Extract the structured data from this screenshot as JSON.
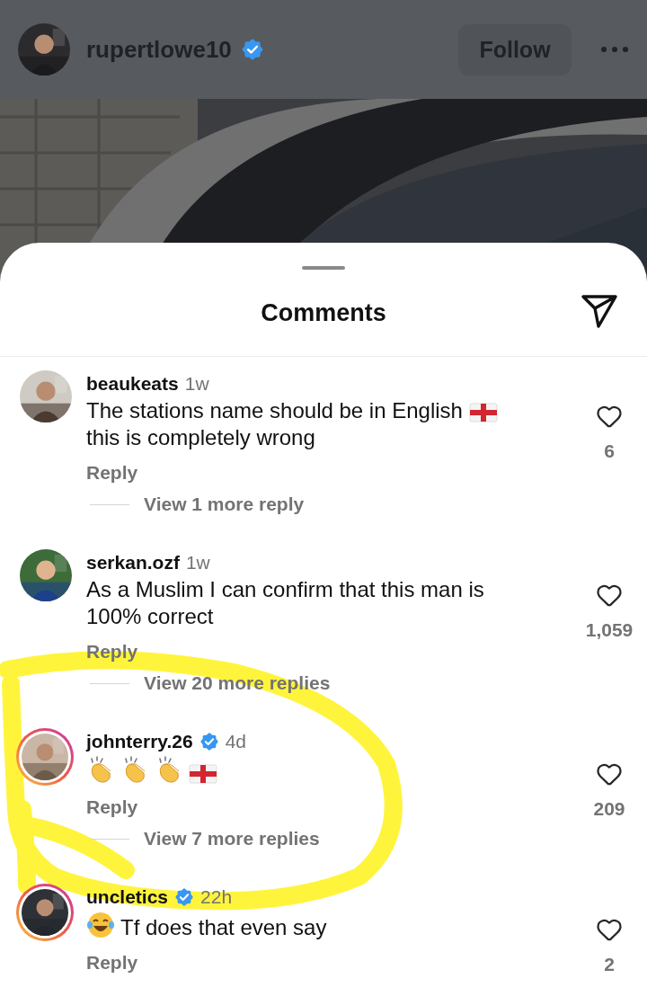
{
  "post_header": {
    "username": "rupertlowe10",
    "verified": true,
    "follow_button": "Follow"
  },
  "sheet": {
    "title": "Comments"
  },
  "comments": [
    {
      "username": "beaukeats",
      "verified": false,
      "story_ring": false,
      "time": "1w",
      "body": [
        {
          "kind": "text",
          "text": "The stations name should be in English"
        },
        {
          "kind": "flag"
        },
        {
          "kind": "text",
          "text": "this is completely wrong"
        }
      ],
      "reply": "Reply",
      "view_replies": "View 1 more reply",
      "likes": "6",
      "liked": false
    },
    {
      "username": "serkan.ozf",
      "verified": false,
      "story_ring": false,
      "time": "1w",
      "body": [
        {
          "kind": "text",
          "text": "As a Muslim I can confirm that this man is 100% correct"
        }
      ],
      "reply": "Reply",
      "view_replies": "View 20 more replies",
      "likes": "1,059",
      "liked": false
    },
    {
      "username": "johnterry.26",
      "verified": true,
      "story_ring": true,
      "time": "4d",
      "body": [
        {
          "kind": "clap"
        },
        {
          "kind": "clap"
        },
        {
          "kind": "clap"
        },
        {
          "kind": "flag"
        }
      ],
      "reply": "Reply",
      "view_replies": "View 7 more replies",
      "likes": "209",
      "liked": false
    },
    {
      "username": "uncletics",
      "verified": true,
      "story_ring": true,
      "time": "22h",
      "body": [
        {
          "kind": "laugh"
        },
        {
          "kind": "text",
          "text": "Tf does that even say"
        }
      ],
      "reply": "Reply",
      "likes": "2",
      "liked": false
    }
  ]
}
